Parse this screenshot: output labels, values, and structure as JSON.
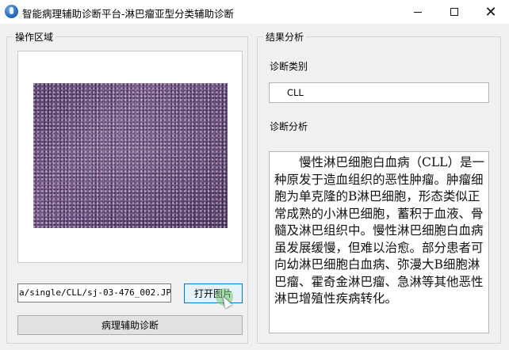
{
  "window": {
    "title": "智能病理辅助诊断平台-淋巴瘤亚型分类辅助诊断",
    "minimize_glyph": "—",
    "close_glyph": "✕"
  },
  "left_panel": {
    "group_title": "操作区域",
    "image_path": "a/single/CLL/sj-03-476_002.JPG",
    "open_button_label": "打开图片",
    "diagnose_button_label": "病理辅助诊断"
  },
  "right_panel": {
    "group_title": "结果分析",
    "category_label": "诊断类别",
    "category_value": "CLL",
    "analysis_label": "诊断分析",
    "analysis_text": "慢性淋巴细胞白血病（CLL）是一种原发于造血组织的恶性肿瘤。肿瘤细胞为单克隆的B淋巴细胞，形态类似正常成熟的小淋巴细胞，蓄积于血液、骨髓及淋巴组织中。慢性淋巴细胞白血病虽发展缓慢，但难以治愈。部分患者可向幼淋巴细胞白血病、弥漫大B细胞淋巴瘤、霍奇金淋巴瘤、急淋等其他恶性淋巴增殖性疾病转化。"
  },
  "icons": {
    "app": "app-logo-icon",
    "minimize": "minimize-icon",
    "maximize": "maximize-icon",
    "close": "close-icon"
  },
  "colors": {
    "accent": "#0078d7",
    "window_bg": "#f0f0f0"
  }
}
